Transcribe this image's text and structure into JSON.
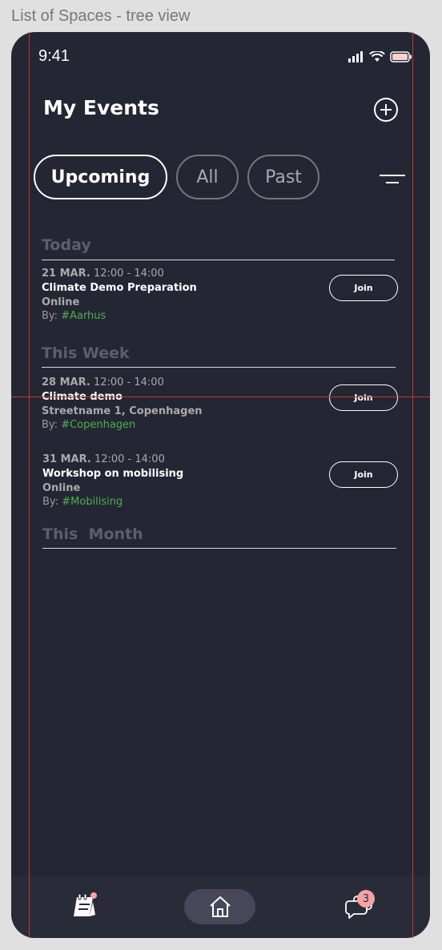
{
  "frame": {
    "title": "List of Spaces - tree view"
  },
  "status_bar": {
    "time": "9:41"
  },
  "header": {
    "title": "My Events",
    "add_icon": "plus-circle-icon"
  },
  "tabs": [
    {
      "label": "Upcoming",
      "active": true
    },
    {
      "label": "All",
      "active": false
    },
    {
      "label": "Past",
      "active": false
    }
  ],
  "sections": [
    {
      "title": "Today"
    },
    {
      "title": "This Week"
    },
    {
      "title": "This  Month"
    }
  ],
  "events": [
    {
      "date": "21 MAR.",
      "time": "12:00 - 14:00",
      "name": "Climate Demo Preparation",
      "place": "Online",
      "by_label": "By:",
      "tag": "#Aarhus",
      "join_label": "Join"
    },
    {
      "date": "28 MAR.",
      "time": "12:00 - 14:00",
      "name": "Climate demo",
      "place": "Streetname 1, Copenhagen",
      "by_label": "By:",
      "tag": "#Copenhagen",
      "join_label": "Join"
    },
    {
      "date": "31 MAR.",
      "time": "12:00 - 14:00",
      "name": "Workshop on mobilising",
      "place": "Online",
      "by_label": "By:",
      "tag": "#Mobilising",
      "join_label": "Join"
    }
  ],
  "bottom_nav": {
    "events_icon": "calendar-notepad-icon",
    "home_icon": "home-icon",
    "chat_icon": "chat-bubbles-icon",
    "chat_badge": "3"
  },
  "colors": {
    "background": "#252633",
    "accent_tag": "#4caf50",
    "badge": "#f4a4a4",
    "guide": "#c0392b"
  }
}
